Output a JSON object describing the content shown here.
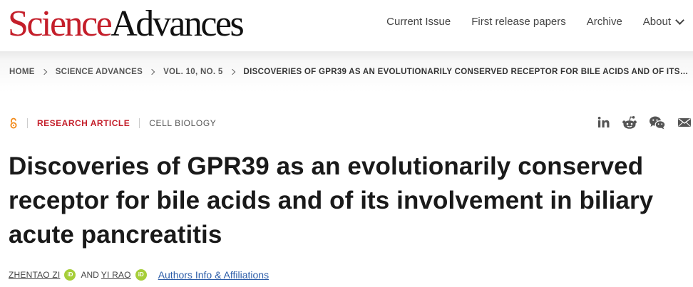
{
  "header": {
    "logo_science": "Science",
    "logo_advances": "Advances",
    "nav": {
      "current_issue": "Current Issue",
      "first_release": "First release papers",
      "archive": "Archive",
      "about": "About"
    }
  },
  "breadcrumb": {
    "items": [
      "HOME",
      "SCIENCE ADVANCES",
      "VOL. 10, NO. 5"
    ],
    "current": "DISCOVERIES OF GPR39 AS AN EVOLUTIONARILY CONSERVED RECEPTOR FOR BILE ACIDS AND OF ITS…"
  },
  "article": {
    "access_icon": "open-access-icon",
    "type": "RESEARCH ARTICLE",
    "subject": "CELL BIOLOGY",
    "title": "Discoveries of GPR39 as an evolutionarily conserved receptor for bile acids and of its involvement in biliary acute pancreatitis",
    "authors": [
      {
        "name": "ZHENTAO ZI",
        "orcid_badge": "iD"
      },
      {
        "name": "YI RAO",
        "orcid_badge": "iD"
      }
    ],
    "authors_joiner": "AND",
    "affiliations_link": "Authors Info & Affiliations"
  },
  "share_icons": [
    "linkedin-icon",
    "reddit-icon",
    "wechat-icon",
    "email-icon"
  ],
  "colors": {
    "brand_red": "#c41e2a",
    "link_blue": "#2b5ca8",
    "orcid_green": "#a6ce39",
    "open_access_orange": "#f28a1a"
  }
}
